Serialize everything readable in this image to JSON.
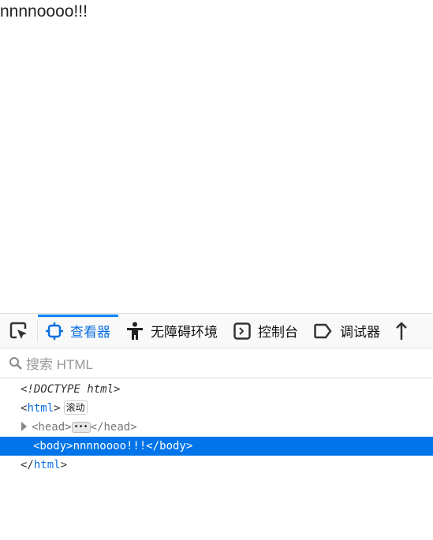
{
  "page": {
    "text": "nnnnoooo!!!"
  },
  "devtools": {
    "tabs": [
      {
        "label": "查看器",
        "icon": "inspector-icon",
        "active": true
      },
      {
        "label": "无障碍环境",
        "icon": "accessibility-icon"
      },
      {
        "label": "控制台",
        "icon": "console-icon"
      },
      {
        "label": "调试器",
        "icon": "debugger-icon"
      }
    ],
    "search_placeholder": "搜索 HTML",
    "tree": {
      "doctype": "<!DOCTYPE html>",
      "html_open_lt": "<",
      "html_tag": "html",
      "html_open_gt": ">",
      "scroll_badge": "滚动",
      "head_open": "<head>",
      "head_ellipsis": "•••",
      "head_close": "</head>",
      "body_line": "<body>nnnnoooo!!!</body>",
      "html_close_lt": "</",
      "html_close_gt": ">"
    },
    "accent_color": "#0074e8"
  }
}
